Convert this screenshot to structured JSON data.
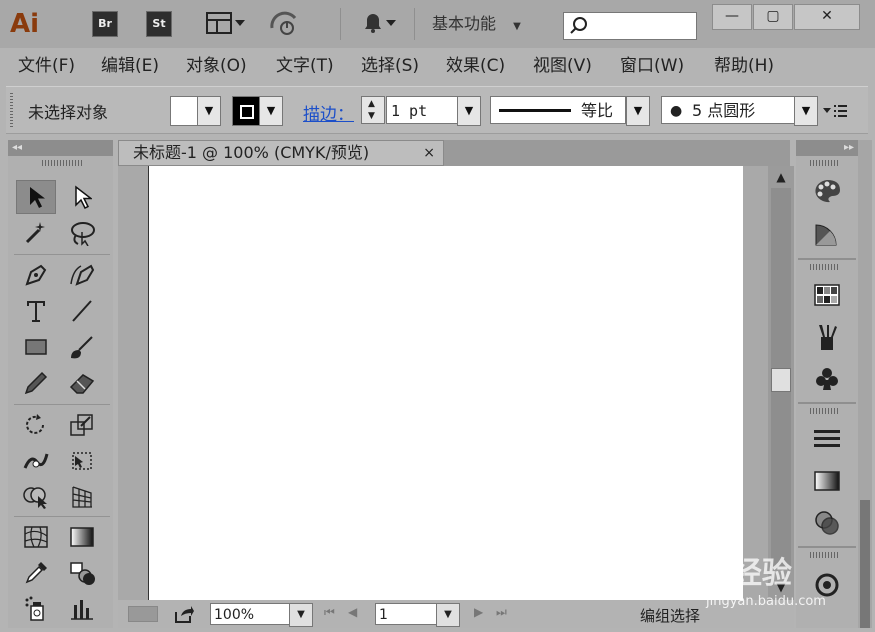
{
  "app": {
    "logo": "Ai",
    "bridge_label": "Br",
    "stock_label": "St",
    "workspace": "基本功能",
    "search": {
      "value": "",
      "placeholder": ""
    }
  },
  "window_controls": {
    "minimize": "—",
    "maximize": "▢",
    "close": "✕"
  },
  "menu": [
    "文件(F)",
    "编辑(E)",
    "对象(O)",
    "文字(T)",
    "选择(S)",
    "效果(C)",
    "视图(V)",
    "窗口(W)",
    "帮助(H)"
  ],
  "control_bar": {
    "selection_status": "未选择对象",
    "stroke_label": "描边：",
    "stroke_weight": "1 pt",
    "profile_label": "等比",
    "brush_label": "5 点圆形"
  },
  "document": {
    "tab_title": "未标题-1 @ 100% (CMYK/预览)",
    "close_glyph": "×"
  },
  "status_bar": {
    "zoom": "100%",
    "artboard_number": "1",
    "tool_status": "编组选择"
  },
  "tools": [
    "selection-tool-icon",
    "direct-selection-tool-icon",
    "magic-wand-tool-icon",
    "lasso-tool-icon",
    "pen-tool-icon",
    "curvature-pen-icon",
    "type-tool-icon",
    "line-segment-tool-icon",
    "rectangle-tool-icon",
    "paintbrush-tool-icon",
    "pencil-tool-icon",
    "eraser-tool-icon",
    "rotate-tool-icon",
    "scale-tool-icon",
    "width-tool-icon",
    "free-transform-tool-icon",
    "shape-builder-tool-icon",
    "perspective-grid-tool-icon",
    "mesh-tool-icon",
    "gradient-tool-icon",
    "eyedropper-tool-icon",
    "blend-tool-icon",
    "symbol-sprayer-tool-icon",
    "column-graph-tool-icon"
  ],
  "right_panel_icons": [
    "color-palette-icon",
    "color-guide-icon",
    "swatches-icon",
    "brushes-icon",
    "symbols-icon",
    "stroke-icon",
    "gradient-icon",
    "transparency-icon",
    "appearance-icon"
  ],
  "watermark": {
    "brand": "Bai 经验",
    "url": "jingyan.baidu.com"
  },
  "colors": {
    "chrome": "#b4b4b4",
    "artboard": "#ffffff",
    "link": "#1c4fc9",
    "logo": "#8a3b0d"
  }
}
